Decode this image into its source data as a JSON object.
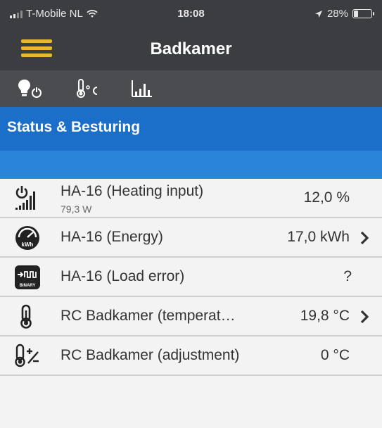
{
  "status_bar": {
    "carrier": "T-Mobile NL",
    "time": "18:08",
    "battery": "28%",
    "battery_level": 0.28
  },
  "nav": {
    "title": "Badkamer",
    "menu_icon": "hamburger-icon"
  },
  "tabs": [
    {
      "icon": "bulb-power-icon",
      "active": true
    },
    {
      "icon": "thermometer-celsius-icon",
      "active": false
    },
    {
      "icon": "bar-chart-icon",
      "active": false
    }
  ],
  "section": {
    "title": "Status & Besturing"
  },
  "rows": [
    {
      "icon": "power-signal-icon",
      "label": "HA-16  (Heating input)",
      "sub": "79,3 W",
      "value": "12,0 %",
      "chevron": false
    },
    {
      "icon": "kwh-meter-icon",
      "label": "HA-16  (Energy)",
      "value": "17,0 kWh",
      "chevron": true
    },
    {
      "icon": "binary-input-icon",
      "label": "HA-16  (Load error)",
      "value": "?",
      "chevron": false
    },
    {
      "icon": "thermometer-icon",
      "label": "RC Badkamer  (temperat…",
      "value": "19,8 °C",
      "chevron": true
    },
    {
      "icon": "thermometer-adjust-icon",
      "label": "RC Badkamer  (adjustment)",
      "value": "0 °C",
      "chevron": false
    }
  ],
  "colors": {
    "bar_dark": "#3b3d40",
    "tab_bar": "#4a4c50",
    "accent_yellow": "#e8b830",
    "header_blue": "#1b6fc9",
    "subheader_blue": "#2a85da",
    "row_bg": "#f3f3f3"
  }
}
